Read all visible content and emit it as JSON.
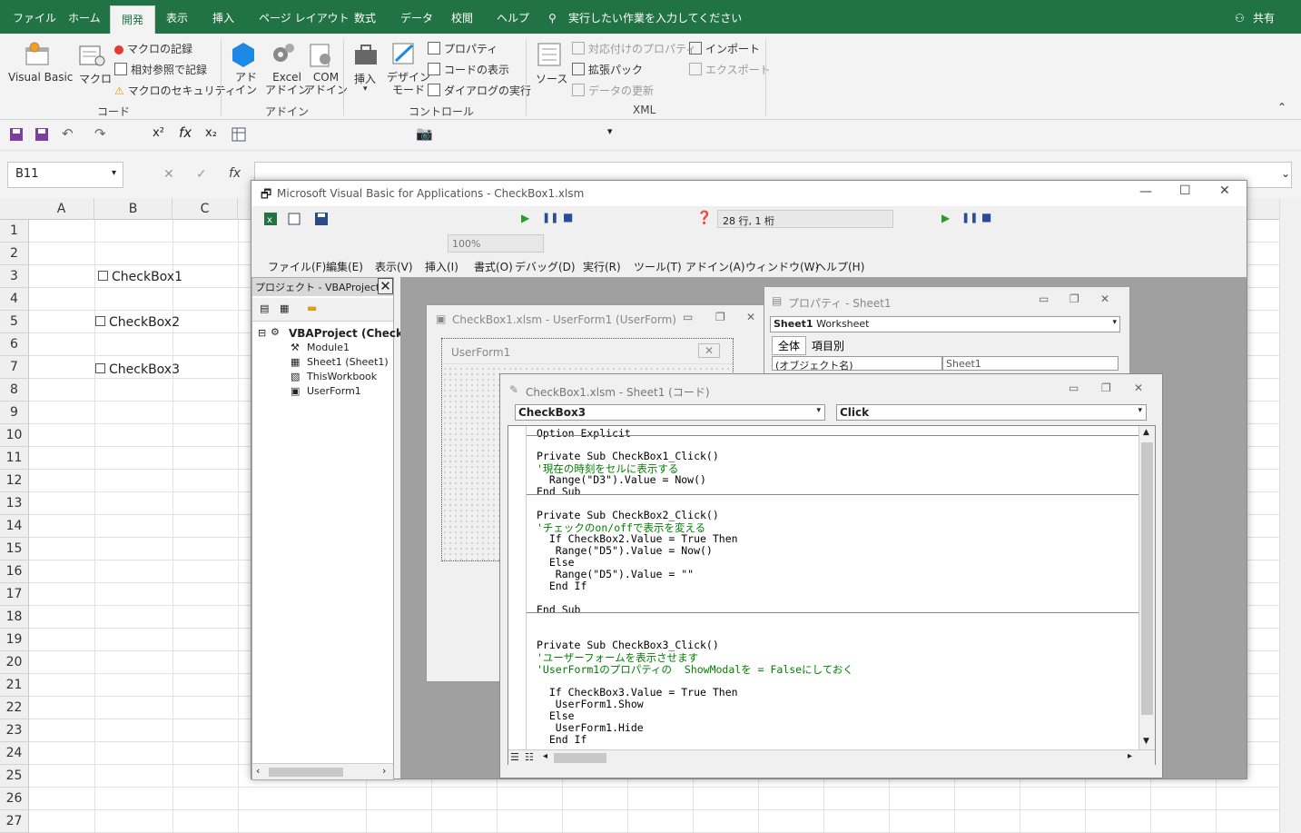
{
  "ribbon": {
    "tabs": [
      "ファイル",
      "ホーム",
      "開発",
      "表示",
      "挿入",
      "ページ レイアウト",
      "数式",
      "データ",
      "校閲",
      "ヘルプ"
    ],
    "active_tab": "開発",
    "search_placeholder": "実行したい作業を入力してください",
    "share": "共有",
    "code_group": {
      "label": "コード",
      "visual_basic": "Visual Basic",
      "macro": "マクロ",
      "record_macro": "マクロの記録",
      "relative_ref": "相対参照で記録",
      "macro_security": "マクロのセキュリティ"
    },
    "addin_group": {
      "label": "アドイン",
      "addin": "アド\nイン",
      "excel_addin": "Excel\nアドイン",
      "com_addin": "COM\nアドイン"
    },
    "control_group": {
      "label": "コントロール",
      "insert": "挿入",
      "design_mode": "デザイン\nモード",
      "properties": "プロパティ",
      "view_code": "コードの表示",
      "run_dialog": "ダイアログの実行"
    },
    "xml_group": {
      "label": "XML",
      "source": "ソース",
      "map_props": "対応付けのプロパティ",
      "expansion": "拡張パック",
      "refresh": "データの更新",
      "import": "インポート",
      "export": "エクスポート"
    }
  },
  "formula_bar": {
    "name_box": "B11",
    "fx": "fx"
  },
  "columns": [
    "A",
    "B",
    "C"
  ],
  "rows": [
    "1",
    "2",
    "3",
    "4",
    "5",
    "6",
    "7",
    "8",
    "9",
    "10",
    "11",
    "12",
    "13",
    "14",
    "15",
    "16",
    "17",
    "18",
    "19",
    "20",
    "21",
    "22",
    "23",
    "24",
    "25",
    "26",
    "27"
  ],
  "sheet_checkboxes": [
    "CheckBox1",
    "CheckBox2",
    "CheckBox3"
  ],
  "vba": {
    "title": "Microsoft Visual Basic for Applications - CheckBox1.xlsm",
    "position": "28 行, 1 桁",
    "zoom": "100%",
    "menus": [
      "ファイル(F)",
      "編集(E)",
      "表示(V)",
      "挿入(I)",
      "書式(O)",
      "デバッグ(D)",
      "実行(R)",
      "ツール(T)",
      "アドイン(A)",
      "ウィンドウ(W)",
      "ヘルプ(H)"
    ],
    "project": {
      "title": "プロジェクト - VBAProject",
      "root": "VBAProject (Check",
      "items": [
        "Module1",
        "Sheet1 (Sheet1)",
        "ThisWorkbook",
        "UserForm1"
      ]
    },
    "userform_window": {
      "title": "CheckBox1.xlsm - UserForm1 (UserForm)",
      "form_caption": "UserForm1"
    },
    "properties_window": {
      "title": "プロパティ - Sheet1",
      "object": "Sheet1",
      "object_type": "Worksheet",
      "tab_all": "全体",
      "tab_category": "項目別",
      "row_name": "(オブジェクト名)",
      "row_value": "Sheet1"
    },
    "code_window": {
      "title": "CheckBox1.xlsm - Sheet1 (コード)",
      "object_combo": "CheckBox3",
      "proc_combo": "Click",
      "lines": [
        {
          "t": "Option Explicit",
          "c": false
        },
        {
          "t": "Private Sub CheckBox1_Click()",
          "c": false
        },
        {
          "t": "'現在の時刻をセルに表示する",
          "c": true
        },
        {
          "t": "  Range(\"D3\").Value = Now()",
          "c": false
        },
        {
          "t": "End Sub",
          "c": false
        },
        {
          "t": "Private Sub CheckBox2_Click()",
          "c": false
        },
        {
          "t": "'チェックのon/offで表示を変える",
          "c": true
        },
        {
          "t": "  If CheckBox2.Value = True Then",
          "c": false
        },
        {
          "t": "   Range(\"D5\").Value = Now()",
          "c": false
        },
        {
          "t": "  Else",
          "c": false
        },
        {
          "t": "   Range(\"D5\").Value = \"\"",
          "c": false
        },
        {
          "t": "  End If",
          "c": false
        },
        {
          "t": "End Sub",
          "c": false
        },
        {
          "t": "Private Sub CheckBox3_Click()",
          "c": false
        },
        {
          "t": "'ユーザーフォームを表示させます",
          "c": true
        },
        {
          "t": "'UserForm1のプロパティの  ShowModalを = Falseにしておく",
          "c": true
        },
        {
          "t": "  If CheckBox3.Value = True Then",
          "c": false
        },
        {
          "t": "   UserForm1.Show",
          "c": false
        },
        {
          "t": "  Else",
          "c": false
        },
        {
          "t": "   UserForm1.Hide",
          "c": false
        },
        {
          "t": "  End If",
          "c": false
        }
      ]
    }
  }
}
